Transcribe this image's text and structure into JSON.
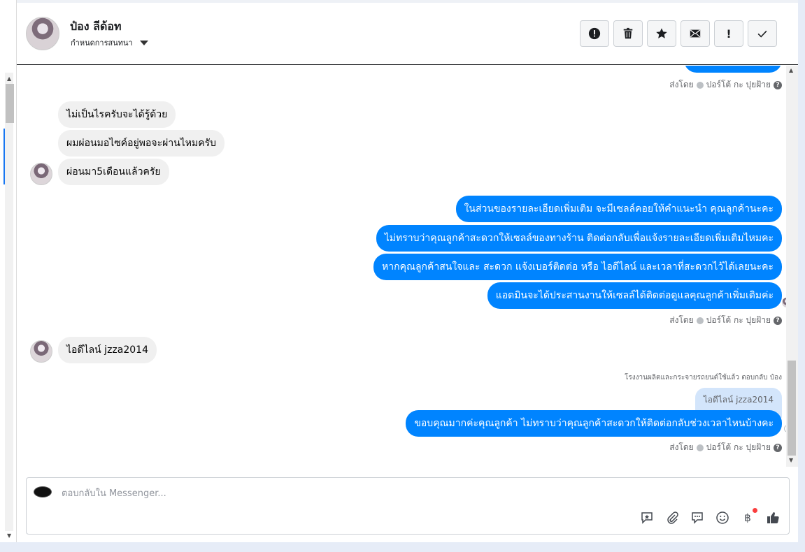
{
  "header": {
    "contact_name": "ป๋อง ลีด้อท",
    "assign_label": "กำหนดการสนทนา",
    "toolbar": [
      {
        "name": "spam-button",
        "icon": "alert-circle-icon"
      },
      {
        "name": "delete-button",
        "icon": "trash-icon"
      },
      {
        "name": "star-button",
        "icon": "star-icon"
      },
      {
        "name": "mark-unread-button",
        "icon": "mail-icon"
      },
      {
        "name": "mark-important-button",
        "icon": "exclamation-icon",
        "glyph": "!"
      },
      {
        "name": "done-button",
        "icon": "check-icon"
      }
    ]
  },
  "chat": {
    "sent_by_prefix": "ส่งโดย",
    "sent_by_name": "ปอร์โต้ กะ ปุยฝ้าย",
    "incoming_1": [
      "ไม่เป็นไรครับจะได้รู้ด้วย",
      "ผมผ่อนมอไซค์อยู่พอจะผ่านไหมครับ",
      "ผ่อนมา5เดือนแล้วครัย"
    ],
    "outgoing_1": [
      "ในส่วนของรายละเอียดเพิ่มเติม จะมีเซลล์คอยให้คำแนะนำ คุณลูกค้านะคะ",
      "ไม่ทราบว่าคุณลูกค้าสะดวกให้เซลล์ของทางร้าน ติดต่อกลับเพื่อแจ้งรายละเอียดเพิ่มเติมไหมคะ",
      "หากคุณลูกค้าสนใจและ สะดวก แจ้งเบอร์ติดต่อ หรือ ไอดีไลน์ และเวลาที่สะดวกไว้ได้เลยนะคะ",
      "แอดมินจะได้ประสานงานให้เซลล์ได้ติดต่อดูแลคุณลูกค้าเพิ่มเติมค่ะ"
    ],
    "incoming_2": "ไอดีไลน์ jzza2014",
    "reply_note": "โรงงานผลิตและกระจายรถยนต์ใช้แล้ว ตอบกลับ ป๋อง",
    "quoted_text": "ไอดีไลน์ jzza2014",
    "outgoing_2": "ขอบคุณมากค่ะคุณลูกค้า ไม่ทราบว่าคุณลูกค้าสะดวกให้ติดต่อกลับช่วงเวลาไหนบ้างคะ"
  },
  "composer": {
    "placeholder": "ตอบกลับใน Messenger...",
    "icons": [
      "saved-reply-icon",
      "attachment-icon",
      "quick-reply-icon",
      "emoji-icon",
      "payment-icon",
      "like-icon"
    ],
    "payment_glyph": "฿"
  },
  "colors": {
    "outgoing_bubble": "#0084ff",
    "incoming_bubble": "#f0f0f0",
    "quoted_bubble": "#d3e5fb"
  }
}
